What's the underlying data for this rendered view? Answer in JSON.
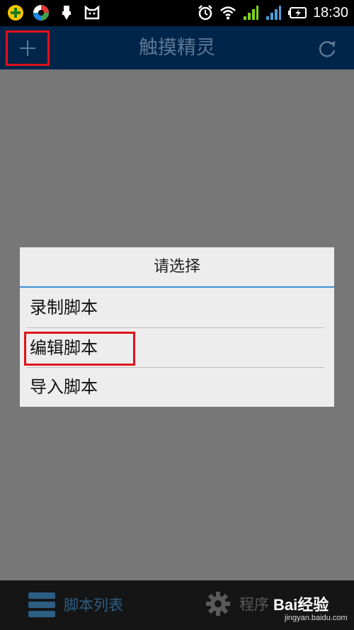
{
  "status_bar": {
    "time": "18:30",
    "icons": [
      "game-center-icon",
      "browser-icon",
      "usb-icon",
      "cat-icon",
      "alarm-icon",
      "wifi-icon",
      "signal-icon",
      "signal-icon",
      "battery-charging-icon"
    ]
  },
  "header": {
    "title": "触摸精灵",
    "add_icon": "plus-icon",
    "refresh_icon": "refresh-icon"
  },
  "dialog": {
    "title": "请选择",
    "items": [
      {
        "label": "录制脚本"
      },
      {
        "label": "编辑脚本"
      },
      {
        "label": "导入脚本"
      }
    ],
    "highlighted_item": "编辑脚本"
  },
  "bottom_nav": {
    "items": [
      {
        "label": "脚本列表",
        "icon": "list-icon"
      },
      {
        "label": "程序",
        "icon": "gear-icon"
      }
    ]
  },
  "watermark": {
    "brand": "Bai经验",
    "url": "jingyan.baidu.com"
  },
  "colors": {
    "appbar": "#00254a",
    "accent_rule": "#3d8fd6",
    "highlight": "#e0121a",
    "overlay": "#777777"
  }
}
